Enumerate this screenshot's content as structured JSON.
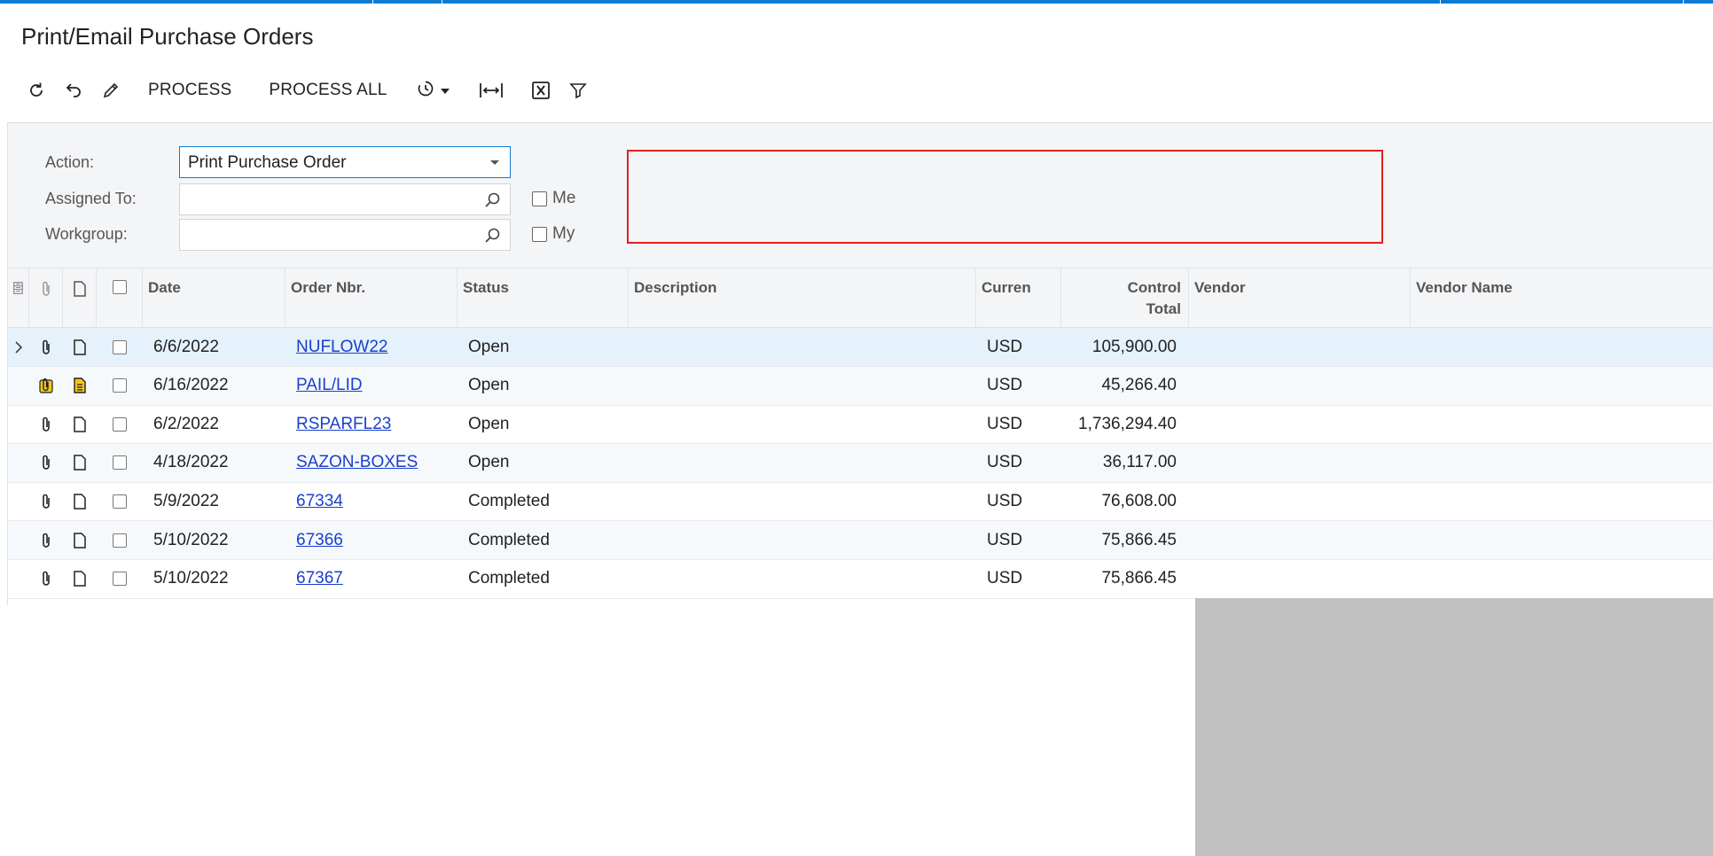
{
  "page": {
    "title": "Print/Email Purchase Orders"
  },
  "toolbar": {
    "refresh_icon": "refresh-icon",
    "undo_icon": "undo-icon",
    "edit_icon": "pencil-icon",
    "process_label": "PROCESS",
    "process_all_label": "PROCESS ALL",
    "schedule_icon": "clock-dropdown-icon",
    "fit_icon": "fit-to-screen-icon",
    "export_icon": "excel-export-icon",
    "filter_icon": "filter-icon"
  },
  "filter": {
    "action_label": "Action:",
    "action_value": "Print Purchase Order",
    "assigned_label": "Assigned To:",
    "assigned_value": "",
    "workgroup_label": "Workgroup:",
    "workgroup_value": "",
    "me_label": "Me",
    "my_label": "My"
  },
  "grid": {
    "columns": {
      "date": "Date",
      "order_nbr": "Order Nbr.",
      "status": "Status",
      "description": "Description",
      "currency": "Curren",
      "control_total_1": "Control",
      "control_total_2": "Total",
      "vendor": "Vendor",
      "vendor_name": "Vendor Name"
    },
    "rows": [
      {
        "date": "6/6/2022",
        "order": "NUFLOW22",
        "status": "Open",
        "currency": "USD",
        "total": "105,900.00",
        "attach": "paperclip-icon",
        "note": "note-icon"
      },
      {
        "date": "6/16/2022",
        "order": "PAIL/LID",
        "status": "Open",
        "currency": "USD",
        "total": "45,266.40",
        "attach": "paperclip-filled-icon",
        "note": "note-filled-icon"
      },
      {
        "date": "6/2/2022",
        "order": "RSPARFL23",
        "status": "Open",
        "currency": "USD",
        "total": "1,736,294.40",
        "attach": "paperclip-icon",
        "note": "note-icon"
      },
      {
        "date": "4/18/2022",
        "order": "SAZON-BOXES",
        "status": "Open",
        "currency": "USD",
        "total": "36,117.00",
        "attach": "paperclip-icon",
        "note": "note-icon"
      },
      {
        "date": "5/9/2022",
        "order": "67334",
        "status": "Completed",
        "currency": "USD",
        "total": "76,608.00",
        "attach": "paperclip-icon",
        "note": "note-icon"
      },
      {
        "date": "5/10/2022",
        "order": "67366",
        "status": "Completed",
        "currency": "USD",
        "total": "75,866.45",
        "attach": "paperclip-icon",
        "note": "note-icon"
      },
      {
        "date": "5/10/2022",
        "order": "67367",
        "status": "Completed",
        "currency": "USD",
        "total": "75,866.45",
        "attach": "paperclip-icon",
        "note": "note-icon"
      }
    ]
  },
  "colors": {
    "accent": "#0e7bd3",
    "link": "#1a3fcc",
    "highlight": "#e02020",
    "note_yellow": "#f5c518"
  }
}
